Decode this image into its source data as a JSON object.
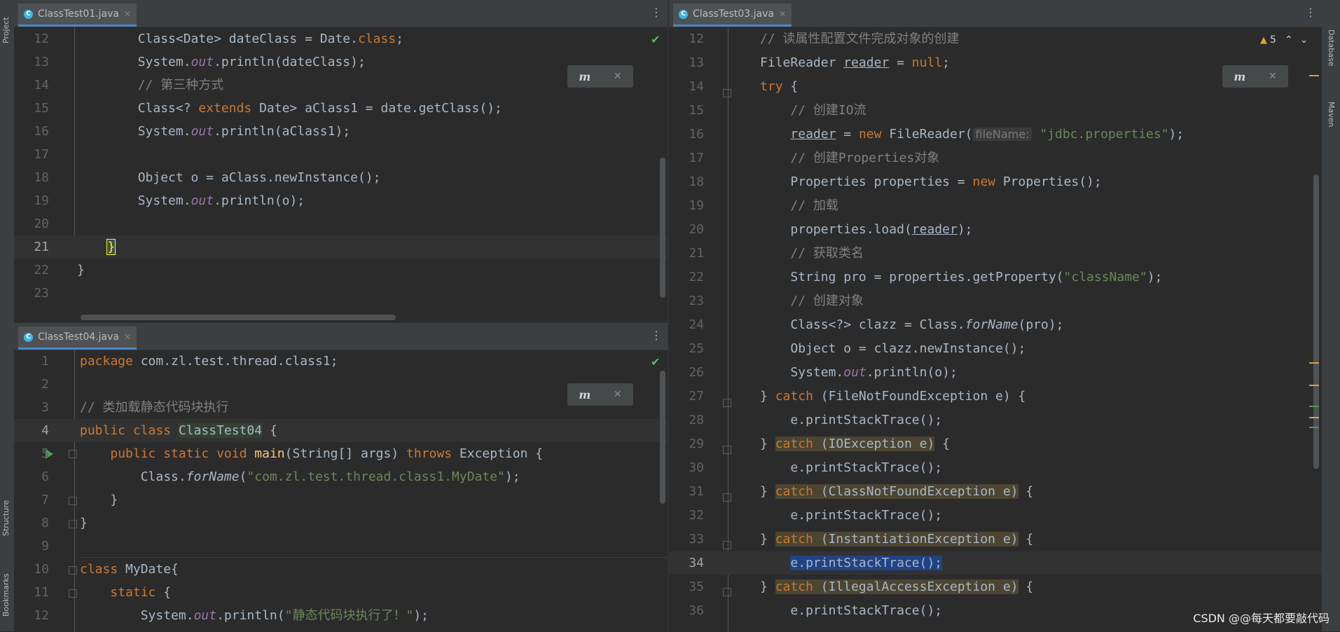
{
  "side_tools": {
    "left": [
      "Project",
      "Structure",
      "Bookmarks"
    ],
    "right": [
      "Database",
      "Maven"
    ]
  },
  "editors": {
    "top_left": {
      "tab": "ClassTest01.java",
      "lines": [
        {
          "n": "12",
          "t": "        Class<Date> dateClass = Date.class;"
        },
        {
          "n": "13",
          "t": "        System.out.println(dateClass);"
        },
        {
          "n": "14",
          "t": "        // 第三种方式"
        },
        {
          "n": "15",
          "t": "        Class<? extends Date> aClass1 = date.getClass();"
        },
        {
          "n": "16",
          "t": "        System.out.println(aClass1);"
        },
        {
          "n": "17",
          "t": ""
        },
        {
          "n": "18",
          "t": "        Object o = aClass.newInstance();"
        },
        {
          "n": "19",
          "t": "        System.out.println(o);"
        },
        {
          "n": "20",
          "t": ""
        },
        {
          "n": "21",
          "t": "    }"
        },
        {
          "n": "22",
          "t": "}"
        },
        {
          "n": "23",
          "t": ""
        }
      ]
    },
    "bottom_left": {
      "tab": "ClassTest04.java",
      "lines": [
        {
          "n": "1",
          "t": "package com.zl.test.thread.class1;"
        },
        {
          "n": "2",
          "t": ""
        },
        {
          "n": "3",
          "t": "// 类加载静态代码块执行"
        },
        {
          "n": "4",
          "t": "public class ClassTest04 {"
        },
        {
          "n": "5",
          "t": "    public static void main(String[] args) throws Exception {"
        },
        {
          "n": "6",
          "t": "        Class.forName(\"com.zl.test.thread.class1.MyDate\");"
        },
        {
          "n": "7",
          "t": "    }"
        },
        {
          "n": "8",
          "t": "}"
        },
        {
          "n": "9",
          "t": ""
        },
        {
          "n": "10",
          "t": "class MyDate{"
        },
        {
          "n": "11",
          "t": "    static {"
        },
        {
          "n": "12",
          "t": "        System.out.println(\"静态代码块执行了！\");"
        }
      ]
    },
    "right": {
      "tab": "ClassTest03.java",
      "warning_count": "5",
      "param_hint": "fileName:",
      "lines": [
        {
          "n": "12",
          "t": "        // 读属性配置文件完成对象的创建"
        },
        {
          "n": "13",
          "t": "        FileReader reader = null;"
        },
        {
          "n": "14",
          "t": "        try {"
        },
        {
          "n": "15",
          "t": "            // 创建IO流"
        },
        {
          "n": "16",
          "t": "            reader = new FileReader(fileName: \"jdbc.properties\");"
        },
        {
          "n": "17",
          "t": "            // 创建Properties对象"
        },
        {
          "n": "18",
          "t": "            Properties properties = new Properties();"
        },
        {
          "n": "19",
          "t": "            // 加载"
        },
        {
          "n": "20",
          "t": "            properties.load(reader);"
        },
        {
          "n": "21",
          "t": "            // 获取类名"
        },
        {
          "n": "22",
          "t": "            String pro = properties.getProperty(\"className\");"
        },
        {
          "n": "23",
          "t": "            // 创建对象"
        },
        {
          "n": "24",
          "t": "            Class<?> clazz = Class.forName(pro);"
        },
        {
          "n": "25",
          "t": "            Object o = clazz.newInstance();"
        },
        {
          "n": "26",
          "t": "            System.out.println(o);"
        },
        {
          "n": "27",
          "t": "        } catch (FileNotFoundException e) {"
        },
        {
          "n": "28",
          "t": "            e.printStackTrace();"
        },
        {
          "n": "29",
          "t": "        } catch (IOException e) {"
        },
        {
          "n": "30",
          "t": "            e.printStackTrace();"
        },
        {
          "n": "31",
          "t": "        } catch (ClassNotFoundException e) {"
        },
        {
          "n": "32",
          "t": "            e.printStackTrace();"
        },
        {
          "n": "33",
          "t": "        } catch (InstantiationException e) {"
        },
        {
          "n": "34",
          "t": "            e.printStackTrace();"
        },
        {
          "n": "35",
          "t": "        } catch (IllegalAccessException e) {"
        },
        {
          "n": "36",
          "t": "            e.printStackTrace();"
        }
      ]
    }
  },
  "watermark": "CSDN @@每天都要敲代码"
}
